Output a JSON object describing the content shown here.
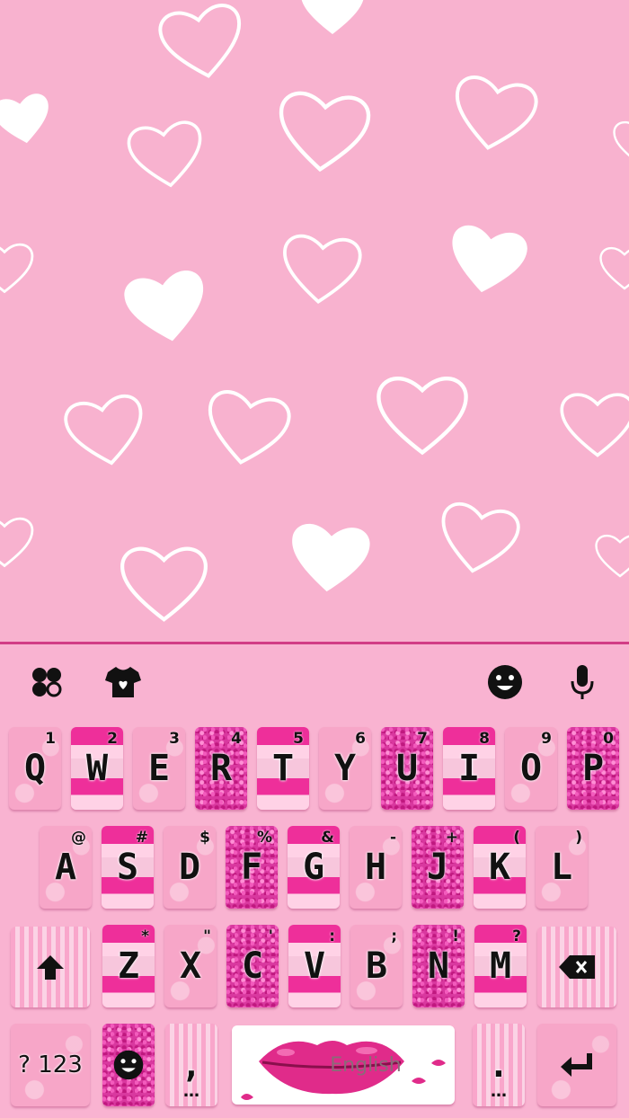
{
  "toolbar": {
    "left_icons": [
      "clover-icon",
      "tshirt-icon"
    ],
    "right_icons": [
      "emoji-icon",
      "microphone-icon"
    ]
  },
  "keyboard": {
    "row1": [
      {
        "label": "Q",
        "hint": "1"
      },
      {
        "label": "W",
        "hint": "2"
      },
      {
        "label": "E",
        "hint": "3"
      },
      {
        "label": "R",
        "hint": "4"
      },
      {
        "label": "T",
        "hint": "5"
      },
      {
        "label": "Y",
        "hint": "6"
      },
      {
        "label": "U",
        "hint": "7"
      },
      {
        "label": "I",
        "hint": "8"
      },
      {
        "label": "O",
        "hint": "9"
      },
      {
        "label": "P",
        "hint": "0"
      }
    ],
    "row2": [
      {
        "label": "A",
        "hint": "@"
      },
      {
        "label": "S",
        "hint": "#"
      },
      {
        "label": "D",
        "hint": "$"
      },
      {
        "label": "F",
        "hint": "%"
      },
      {
        "label": "G",
        "hint": "&"
      },
      {
        "label": "H",
        "hint": "-"
      },
      {
        "label": "J",
        "hint": "+"
      },
      {
        "label": "K",
        "hint": "("
      },
      {
        "label": "L",
        "hint": ")"
      }
    ],
    "row3": [
      {
        "label": "Z",
        "hint": "*"
      },
      {
        "label": "X",
        "hint": "\""
      },
      {
        "label": "C",
        "hint": "'"
      },
      {
        "label": "V",
        "hint": ":"
      },
      {
        "label": "B",
        "hint": ";"
      },
      {
        "label": "N",
        "hint": "!"
      },
      {
        "label": "M",
        "hint": "?"
      }
    ],
    "symbols_label": "? 123",
    "comma_label": ",",
    "space_label": "English",
    "period_label": "."
  },
  "colors": {
    "wallpaper": "#f8b2cf",
    "keyboard_bg": "#f9b3d1",
    "accent_magenta": "#ee2f9a",
    "divider": "#d23d86"
  }
}
